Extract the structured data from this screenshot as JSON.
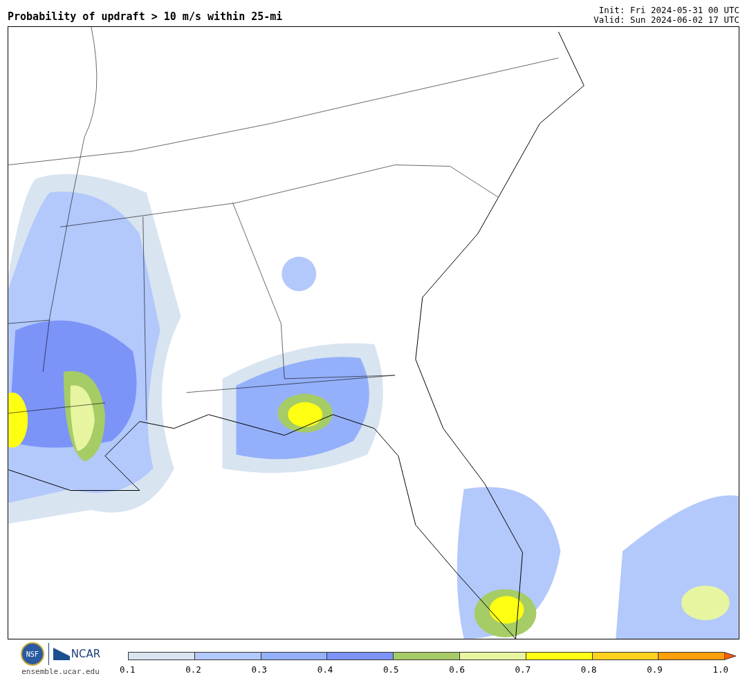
{
  "title": "Probability of updraft > 10 m/s within 25-mi",
  "init": "Init: Fri 2024-05-31 00 UTC",
  "valid": "Valid: Sun 2024-06-02 17 UTC",
  "logos": {
    "nsf": "NSF",
    "ncar": "NCAR",
    "site": "ensemble.ucar.edu"
  },
  "colorbar": {
    "bins": [
      {
        "kind": "swatch",
        "color": "#d8e4f0"
      },
      {
        "kind": "swatch",
        "color": "#b3c8fb"
      },
      {
        "kind": "swatch",
        "color": "#95b0fa"
      },
      {
        "kind": "swatch",
        "color": "#7c93f8"
      },
      {
        "kind": "swatch",
        "color": "#a6cc66"
      },
      {
        "kind": "swatch",
        "color": "#e8f5a0"
      },
      {
        "kind": "swatch",
        "color": "#ffff14"
      },
      {
        "kind": "swatch",
        "color": "#ffd21f"
      },
      {
        "kind": "swatch",
        "color": "#ff9d0a"
      },
      {
        "kind": "arrow",
        "color": "#ff5a00"
      }
    ],
    "ticks": [
      "0.1",
      "0.2",
      "0.3",
      "0.4",
      "0.5",
      "0.6",
      "0.7",
      "0.8",
      "0.9",
      "1.0"
    ]
  }
}
